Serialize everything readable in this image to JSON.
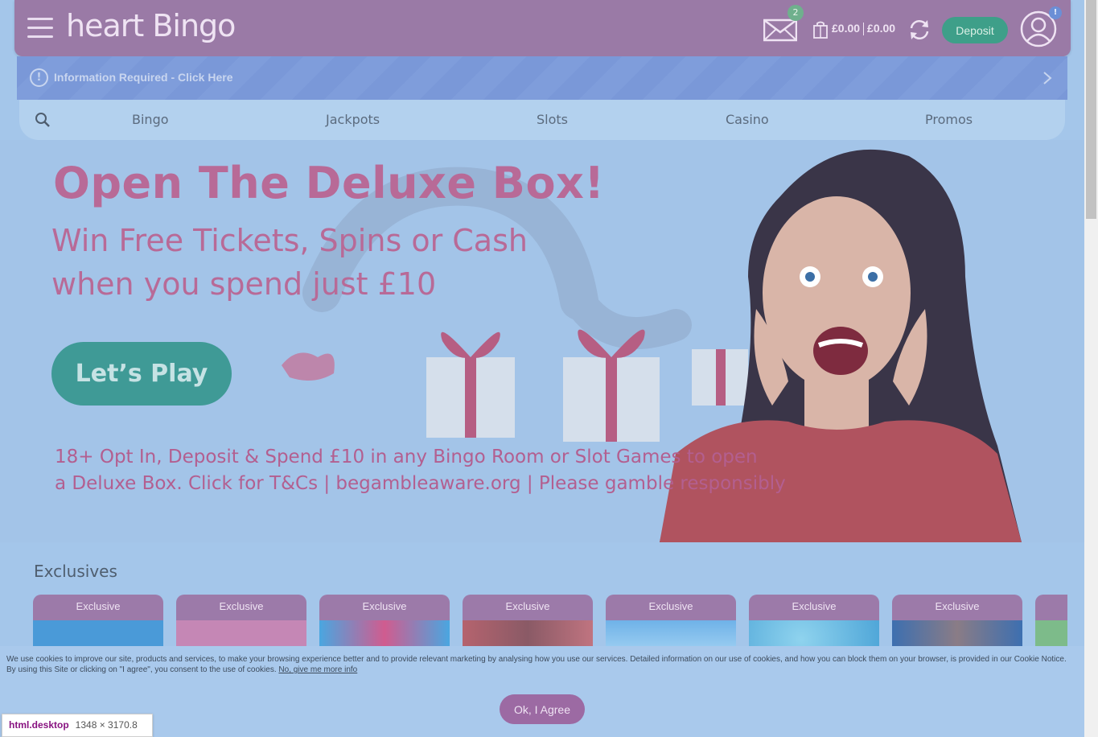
{
  "header": {
    "logo_text": "heart Bingo",
    "mail_count": "2",
    "cash_balance": "£0.00",
    "bonus_balance": "£0.00",
    "deposit_label": "Deposit",
    "account_badge": "!",
    "icons": [
      "menu-icon",
      "mail-icon",
      "bag-icon",
      "refresh-icon",
      "account-icon"
    ]
  },
  "info_bar": {
    "icon": "!",
    "text": "Information Required - Click Here"
  },
  "nav": {
    "items": [
      {
        "label": "Bingo"
      },
      {
        "label": "Jackpots"
      },
      {
        "label": "Slots"
      },
      {
        "label": "Casino"
      },
      {
        "label": "Promos"
      }
    ]
  },
  "hero": {
    "title": "Open The Deluxe Box!",
    "subtitle_line1": "Win Free Tickets, Spins or Cash",
    "subtitle_line2": "when you spend just £10",
    "cta_label": "Let’s Play",
    "terms_line1": "18+ Opt In, Deposit & Spend £10 in any Bingo Room or Slot Games to open",
    "terms_line2": "a Deluxe Box. Click for T&Cs | begambleaware.org | Please gamble responsibly"
  },
  "exclusives": {
    "title": "Exclusives",
    "cards": [
      {
        "label": "Exclusive"
      },
      {
        "label": "Exclusive"
      },
      {
        "label": "Exclusive"
      },
      {
        "label": "Exclusive"
      },
      {
        "label": "Exclusive"
      },
      {
        "label": "Exclusive"
      },
      {
        "label": "Exclusive"
      }
    ]
  },
  "cookie": {
    "text_line1": "We use cookies to improve our site, products and services, to make your browsing experience better and to provide relevant marketing by analysing how you use our services. Detailed information on our use of cookies, and how you can block them on your browser, is provided in our Cookie Notice.",
    "text_line2_prefix": "By using this Site or clicking on \"I agree\", you consent to the use of cookies. ",
    "link_text": "No, give me more info",
    "agree_label": "Ok, I Agree"
  },
  "devtools_tooltip": {
    "element": "html.desktop",
    "size": "1348 × 3170.8"
  },
  "colors": {
    "header_bg": "#9a7aa6",
    "deposit_green": "#3e9f89",
    "hero_pink": "#b86a97",
    "page_bg": "#a4c6ea"
  }
}
